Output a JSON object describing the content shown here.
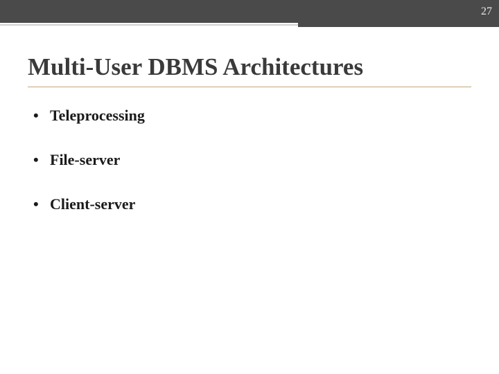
{
  "slide": {
    "number": "27",
    "title": "Multi-User DBMS Architectures",
    "bullets": [
      "Teleprocessing",
      "File-server",
      "Client-server"
    ]
  }
}
